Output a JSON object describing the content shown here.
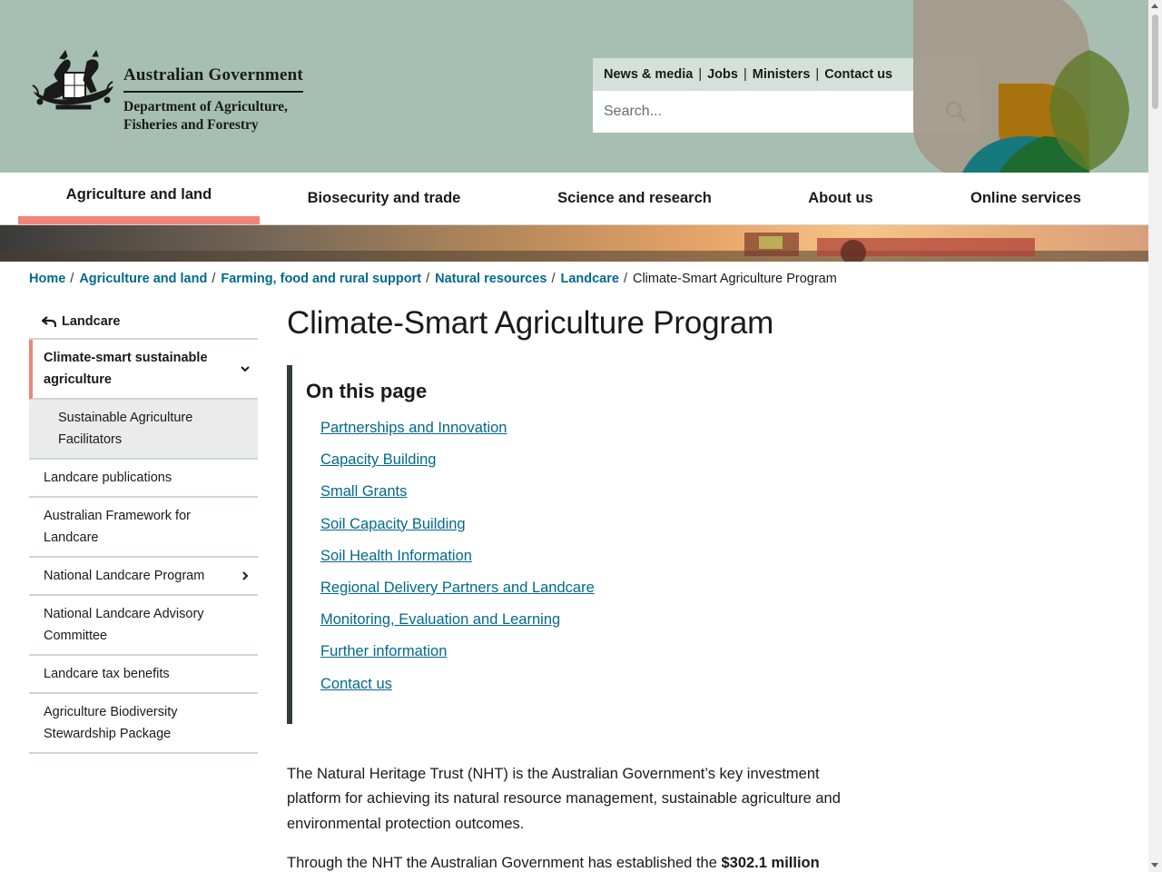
{
  "header": {
    "gov_name": "Australian Government",
    "dept_line1": "Department of Agriculture,",
    "dept_line2": "Fisheries and Forestry",
    "utility_links": [
      "News & media",
      "Jobs",
      "Ministers",
      "Contact us"
    ],
    "search_placeholder": "Search..."
  },
  "nav": {
    "items": [
      "Agriculture and land",
      "Biosecurity and trade",
      "Science and research",
      "About us",
      "Online services"
    ],
    "active": "Agriculture and land"
  },
  "breadcrumb": {
    "links": [
      "Home",
      "Agriculture and land",
      "Farming, food and rural support",
      "Natural resources",
      "Landcare"
    ],
    "current": "Climate-Smart Agriculture Program"
  },
  "sidebar": {
    "back_label": "Landcare",
    "items": [
      "Climate-smart sustainable agriculture",
      "Sustainable Agriculture Facilitators",
      "Landcare publications",
      "Australian Framework for Landcare",
      "National Landcare Program",
      "National Landcare Advisory Committee",
      "Landcare tax benefits",
      "Agriculture Biodiversity Stewardship Package"
    ]
  },
  "main": {
    "title": "Climate-Smart Agriculture Program",
    "on_this_page_heading": "On this page",
    "on_this_page_links": [
      "Partnerships and Innovation",
      "Capacity Building",
      "Small Grants",
      "Soil Capacity Building",
      "Soil Health Information",
      "Regional Delivery Partners and Landcare",
      "Monitoring, Evaluation and Learning",
      "Further information",
      "Contact us "
    ],
    "para1": "The Natural Heritage Trust (NHT) is the Australian Government’s key investment platform for achieving its natural resource management, sustainable agriculture and environmental protection outcomes.",
    "para2_start": "Through the NHT the Australian Government has established the ",
    "para2_bold": "$302.1 million"
  },
  "colors": {
    "header_bg": "#a6bfb2",
    "link": "#00698f",
    "accent": "#f08478",
    "otp_border": "#313d38"
  }
}
